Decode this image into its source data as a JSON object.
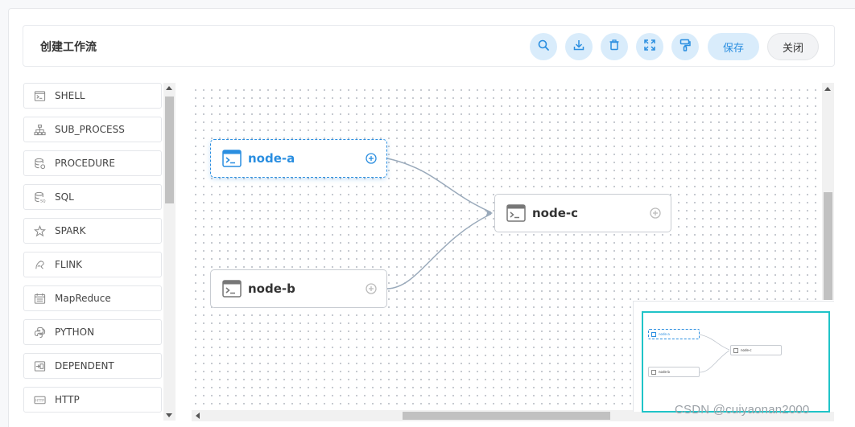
{
  "toolbar": {
    "title": "创建工作流",
    "icons": [
      "search-icon",
      "download-icon",
      "delete-icon",
      "fullscreen-icon",
      "format-brush-icon"
    ],
    "save_label": "保存",
    "close_label": "关闭"
  },
  "sidebar": {
    "items": [
      {
        "label": "SHELL",
        "icon": "shell-icon"
      },
      {
        "label": "SUB_PROCESS",
        "icon": "sub-process-icon"
      },
      {
        "label": "PROCEDURE",
        "icon": "procedure-icon"
      },
      {
        "label": "SQL",
        "icon": "sql-icon"
      },
      {
        "label": "SPARK",
        "icon": "spark-icon"
      },
      {
        "label": "FLINK",
        "icon": "flink-icon"
      },
      {
        "label": "MapReduce",
        "icon": "mapreduce-icon"
      },
      {
        "label": "PYTHON",
        "icon": "python-icon"
      },
      {
        "label": "DEPENDENT",
        "icon": "dependent-icon"
      },
      {
        "label": "HTTP",
        "icon": "http-icon"
      }
    ]
  },
  "canvas": {
    "nodes": [
      {
        "id": "node-a",
        "label": "node-a",
        "selected": true
      },
      {
        "id": "node-b",
        "label": "node-b",
        "selected": false
      },
      {
        "id": "node-c",
        "label": "node-c",
        "selected": false
      }
    ],
    "edges": [
      {
        "from": "node-a",
        "to": "node-c"
      },
      {
        "from": "node-b",
        "to": "node-c"
      }
    ]
  },
  "minimap": {
    "nodes": [
      {
        "label": "node-a"
      },
      {
        "label": "node-b"
      },
      {
        "label": "node-c"
      }
    ]
  },
  "watermark": "CSDN @cuiyaonan2000",
  "colors": {
    "accent": "#2a8ee0",
    "accent_light": "#d9ecfb",
    "minimap_frame": "#20c4c8",
    "edge": "#9aaabb"
  }
}
